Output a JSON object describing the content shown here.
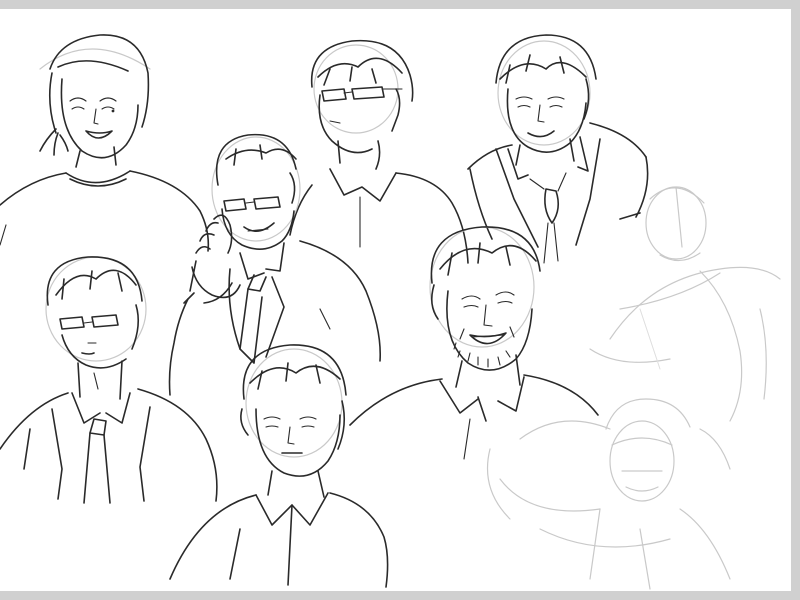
{
  "colors": {
    "frame": "#d0d0d0",
    "canvas": "#ffffff",
    "ink": "#2a2a2a",
    "guide": "#c9c9c9"
  },
  "sketches": [
    {
      "name": "laughing-ponytail-man"
    },
    {
      "name": "glasses-man-looking-up-right"
    },
    {
      "name": "smiling-man-jacket-loose-tie"
    },
    {
      "name": "glasses-man-hand-to-face-smile"
    },
    {
      "name": "glasses-man-looking-up-tie"
    },
    {
      "name": "man-straight-face-open-collar"
    },
    {
      "name": "bearded-man-grinning"
    },
    {
      "name": "faint-rough-figure-arm-up"
    },
    {
      "name": "faint-rough-figure-arm-behind-head"
    }
  ]
}
